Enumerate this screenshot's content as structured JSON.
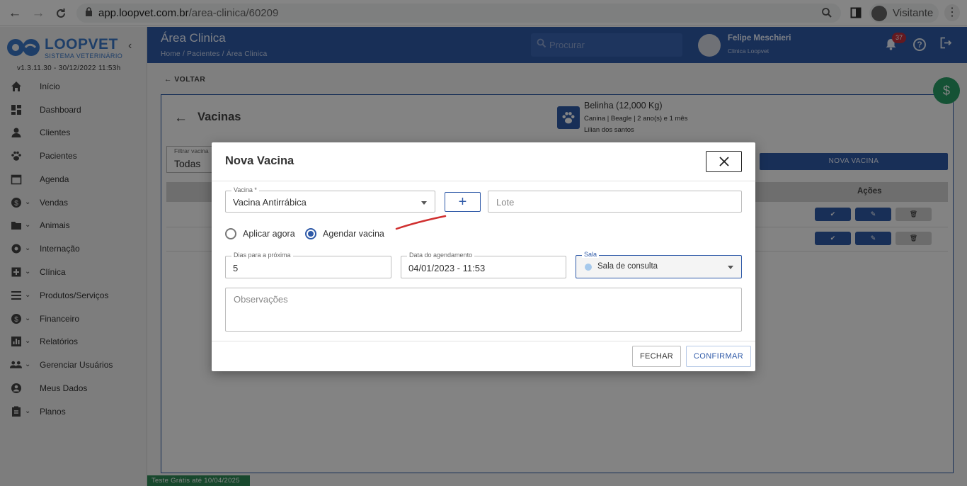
{
  "browser": {
    "url_host": "app.loopvet.com.br",
    "url_path": "/area-clinica/60209",
    "profile_label": "Visitante"
  },
  "sidebar": {
    "logo_text": "LOOPVET",
    "logo_subtitle": "SISTEMA VETERINÁRIO",
    "version": "v1.3.11.30 - 30/12/2022 11:53h",
    "items": [
      {
        "label": "Início",
        "icon": "home-icon",
        "expandable": false
      },
      {
        "label": "Dashboard",
        "icon": "dashboard-icon",
        "expandable": false
      },
      {
        "label": "Clientes",
        "icon": "person-icon",
        "expandable": false
      },
      {
        "label": "Pacientes",
        "icon": "paw-icon",
        "expandable": false
      },
      {
        "label": "Agenda",
        "icon": "calendar-icon",
        "expandable": false
      },
      {
        "label": "Vendas",
        "icon": "dollar-icon",
        "expandable": true
      },
      {
        "label": "Animais",
        "icon": "folder-icon",
        "expandable": true
      },
      {
        "label": "Internação",
        "icon": "settings-icon",
        "expandable": true
      },
      {
        "label": "Clínica",
        "icon": "medical-icon",
        "expandable": true
      },
      {
        "label": "Produtos/Serviços",
        "icon": "list-icon",
        "expandable": true
      },
      {
        "label": "Financeiro",
        "icon": "dollar-icon",
        "expandable": true
      },
      {
        "label": "Relatórios",
        "icon": "chart-icon",
        "expandable": true
      },
      {
        "label": "Gerenciar Usuários",
        "icon": "group-icon",
        "expandable": true
      },
      {
        "label": "Meus Dados",
        "icon": "account-icon",
        "expandable": false
      },
      {
        "label": "Planos",
        "icon": "clipboard-icon",
        "expandable": true
      }
    ],
    "trial_text": "Teste Grátis até 10/04/2025"
  },
  "header": {
    "title": "Área Clinica",
    "breadcrumb": "Home  /  Pacientes  /  Área Clinica",
    "search_placeholder": "Procurar",
    "user_name": "Felipe Meschieri",
    "user_clinic": "Clinica Loopvet",
    "notification_count": "37"
  },
  "page": {
    "back_label": "VOLTAR",
    "card_title": "Vacinas",
    "pet_name": "Belinha (12,000 Kg)",
    "pet_info": "Canina | Beagle | 2 ano(s) e 1 mês",
    "pet_owner": "Lilian dos santos",
    "filter_label": "Filtrar vacina",
    "filter_value": "Todas",
    "new_button": "NOVA VACINA",
    "table_actions_header": "Ações"
  },
  "modal": {
    "title": "Nova Vacina",
    "vacina_label": "Vacina *",
    "vacina_value": "Vacina Antirrábica",
    "lote_placeholder": "Lote",
    "radio_aplicar": "Aplicar agora",
    "radio_agendar": "Agendar vacina",
    "selected_radio": "Agendar vacina",
    "dias_label": "Dias para a próxima",
    "dias_value": "5",
    "data_label": "Data do agendamento",
    "data_value": "04/01/2023 - 11:53",
    "sala_label": "Sala",
    "sala_value": "Sala de consulta",
    "obs_placeholder": "Observações",
    "fechar": "FECHAR",
    "confirmar": "CONFIRMAR"
  },
  "colors": {
    "primary": "#2f5aa8",
    "trial_green": "#2e8b57",
    "fab_green": "#2a9d66",
    "badge_red": "#c0303f",
    "annotation_red": "#d03030"
  }
}
